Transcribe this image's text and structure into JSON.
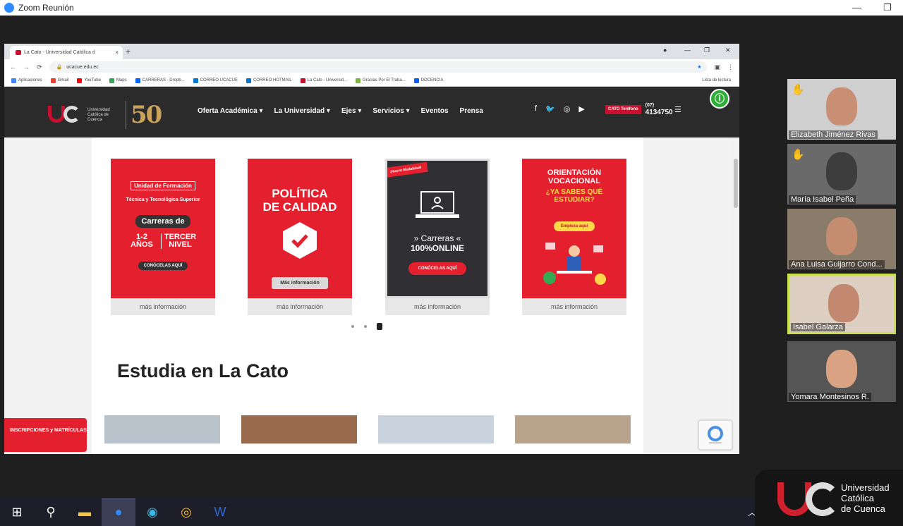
{
  "zoom": {
    "title": "Zoom Reunión",
    "minimize": "—",
    "restore": "❐"
  },
  "browser": {
    "tab_title": "La Cato - Universidad Católica d",
    "tab_close": "×",
    "new_tab": "+",
    "url": "ucacue.edu.ec",
    "bookmarks": [
      {
        "label": "Aplicaciones",
        "color": "#4285f4"
      },
      {
        "label": "Gmail",
        "color": "#ea4335"
      },
      {
        "label": "YouTube",
        "color": "#ff0000"
      },
      {
        "label": "Maps",
        "color": "#34a853"
      },
      {
        "label": "CARRERAS - Dropb...",
        "color": "#0061fe"
      },
      {
        "label": "CORREO UCACUE",
        "color": "#0078d4"
      },
      {
        "label": "CORREO HOTMAIL",
        "color": "#0078d4"
      },
      {
        "label": "La Cato - Universid...",
        "color": "#c8102e"
      },
      {
        "label": "Gracias Por El Traba...",
        "color": "#7cb342"
      },
      {
        "label": "DOCENCIA",
        "color": "#0061fe"
      }
    ],
    "reading_list": "Lista de lectura"
  },
  "site": {
    "logo_name": "Universidad Católica de Cuenca",
    "logo_years": "50",
    "nav": [
      "Oferta Académica ▾",
      "La Universidad ▾",
      "Ejes ▾",
      "Servicios ▾",
      "Eventos",
      "Prensa"
    ],
    "social": [
      "f",
      "🐦",
      "◎",
      "▶"
    ],
    "phone_badge": "CATO Teléfono",
    "phone_prefix": "(07)",
    "phone_number": "4134750",
    "cards": [
      {
        "lines": [
          "Unidad de Formación",
          "Técnica y Tecnológica Superior",
          "Carreras de",
          "1-2 AÑOS",
          "TERCER NIVEL",
          "CONÓCELAS AQUÍ"
        ],
        "more": "más información"
      },
      {
        "lines": [
          "POLÍTICA",
          "DE CALIDAD",
          "Más información"
        ],
        "more": "más información"
      },
      {
        "lines": [
          "¡Nuevo Modalidad!",
          "» Carreras «",
          "100%ONLINE",
          "CONÓCELAS AQUÍ"
        ],
        "more": "más información"
      },
      {
        "lines": [
          "ORIENTACIÓN VOCACIONAL",
          "¿YA SABES QUÉ ESTUDIAR?",
          "Empieza aquí"
        ],
        "more": "más información"
      }
    ],
    "section_title": "Estudia en La Cato",
    "side_cta": "INSCRIPCIONES y MATRÍCULAS"
  },
  "participants": [
    {
      "name": "Elizabeth Jiménez Rivas",
      "bg": "#cfcfcf",
      "face": "#c98f75",
      "hand": true
    },
    {
      "name": "María Isabel Peña",
      "bg": "#6a6a6a",
      "face": "#3d3d3d",
      "hand": true
    },
    {
      "name": "Ana Luisa Guijarro Cond...",
      "bg": "#8a7c6a",
      "face": "#c58d6f",
      "hand": false
    },
    {
      "name": "Isabel Galarza",
      "bg": "#ddd0c2",
      "face": "#c38870",
      "hand": false
    },
    {
      "name": "Yomara Montesinos R.",
      "bg": "#555555",
      "face": "#d8a283",
      "hand": false
    }
  ],
  "brand": {
    "line1": "Universidad",
    "line2": "Católica",
    "line3": "de Cuenca"
  }
}
